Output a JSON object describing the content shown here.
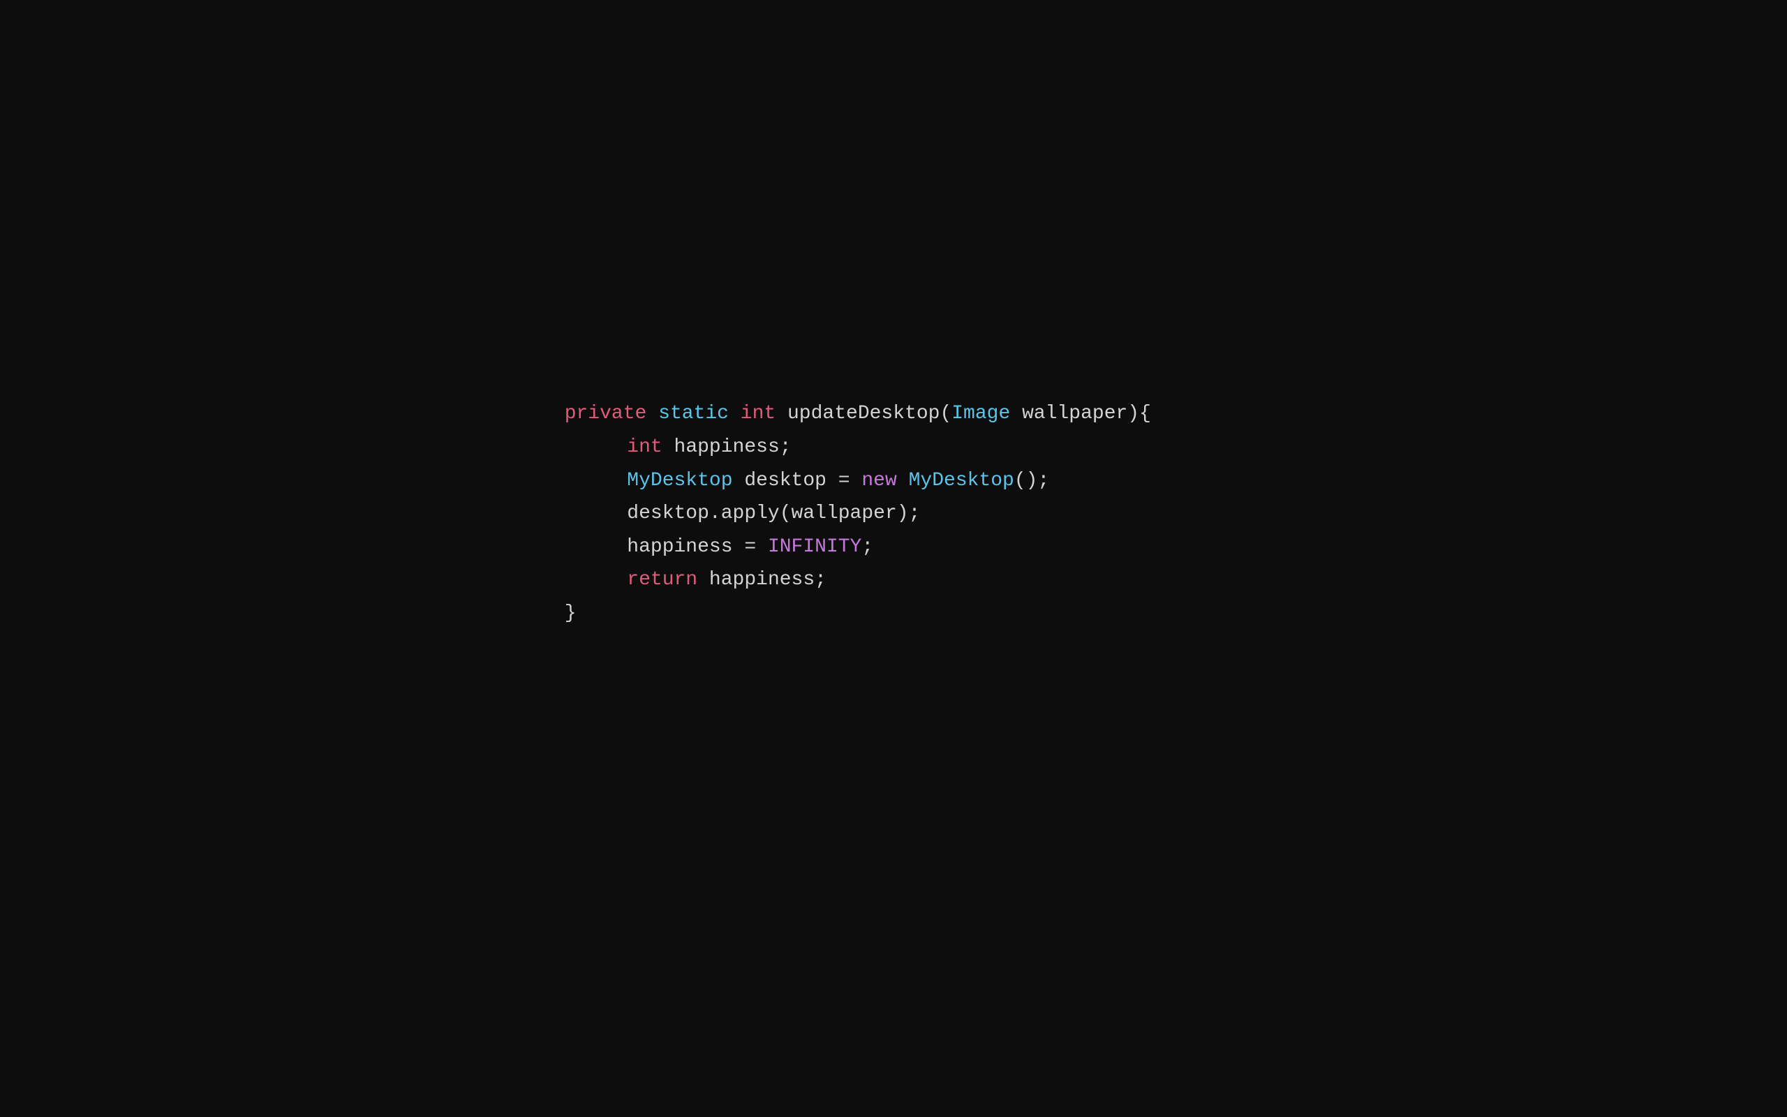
{
  "background": "#0d0d0d",
  "code": {
    "line1": {
      "parts": [
        {
          "text": "private",
          "class": "kw-private"
        },
        {
          "text": " ",
          "class": "plain"
        },
        {
          "text": "static",
          "class": "kw-static"
        },
        {
          "text": " ",
          "class": "plain"
        },
        {
          "text": "int",
          "class": "kw-int"
        },
        {
          "text": " updateDesktop(",
          "class": "plain"
        },
        {
          "text": "Image",
          "class": "type-image"
        },
        {
          "text": " wallpaper){",
          "class": "plain"
        }
      ]
    },
    "line2": {
      "indent": "indent1",
      "parts": [
        {
          "text": "int",
          "class": "kw-int"
        },
        {
          "text": " happiness;",
          "class": "plain"
        }
      ]
    },
    "line3": {
      "indent": "indent1",
      "parts": [
        {
          "text": "MyDesktop",
          "class": "type-mydesktop"
        },
        {
          "text": " desktop = ",
          "class": "plain"
        },
        {
          "text": "new",
          "class": "kw-new"
        },
        {
          "text": " ",
          "class": "plain"
        },
        {
          "text": "MyDesktop",
          "class": "type-mydesktop"
        },
        {
          "text": "();",
          "class": "plain"
        }
      ]
    },
    "line4": {
      "indent": "indent1",
      "parts": [
        {
          "text": "desktop.apply(wallpaper);",
          "class": "plain"
        }
      ]
    },
    "line5": {
      "indent": "indent1",
      "parts": [
        {
          "text": "happiness = ",
          "class": "plain"
        },
        {
          "text": "INFINITY",
          "class": "val-infinity"
        },
        {
          "text": ";",
          "class": "plain"
        }
      ]
    },
    "line6": {
      "indent": "indent1",
      "parts": [
        {
          "text": "return",
          "class": "kw-return"
        },
        {
          "text": " happiness;",
          "class": "plain"
        }
      ]
    },
    "line7": {
      "parts": [
        {
          "text": "}",
          "class": "plain"
        }
      ]
    }
  }
}
